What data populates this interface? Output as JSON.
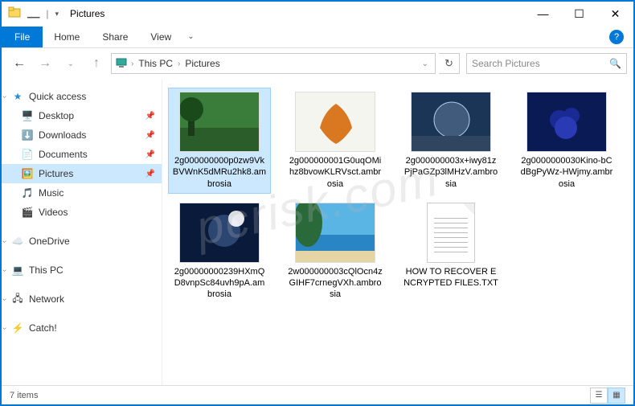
{
  "titlebar": {
    "title": "Pictures"
  },
  "ribbon": {
    "file": "File",
    "tabs": [
      "Home",
      "Share",
      "View"
    ]
  },
  "breadcrumb": {
    "root": "This PC",
    "folder": "Pictures"
  },
  "search": {
    "placeholder": "Search Pictures"
  },
  "nav": {
    "quick_access": "Quick access",
    "items": [
      {
        "label": "Desktop"
      },
      {
        "label": "Downloads"
      },
      {
        "label": "Documents"
      },
      {
        "label": "Pictures"
      },
      {
        "label": "Music"
      },
      {
        "label": "Videos"
      }
    ],
    "onedrive": "OneDrive",
    "this_pc": "This PC",
    "network": "Network",
    "catch": "Catch!"
  },
  "files": [
    {
      "name": "2g000000000p0zw9VkBVWnK5dMRu2hk8.ambrosia"
    },
    {
      "name": "2g000000001G0uqOMihz8bvowKLRVsct.ambrosia"
    },
    {
      "name": "2g000000003x+iwy81zPjPaGZp3lMHzV.ambrosia"
    },
    {
      "name": "2g0000000030Kino-bCdBgPyWz-HWjmy.ambrosia"
    },
    {
      "name": "2g00000000239HXmQD8vnpSc84uvh9pA.ambrosia"
    },
    {
      "name": "2w000000003cQlOcn4zGIHF7crnegVXh.ambrosia"
    },
    {
      "name": "HOW TO RECOVER ENCRYPTED FILES.TXT"
    }
  ],
  "status": {
    "count": "7 items"
  },
  "watermark": "pcrisk.com"
}
